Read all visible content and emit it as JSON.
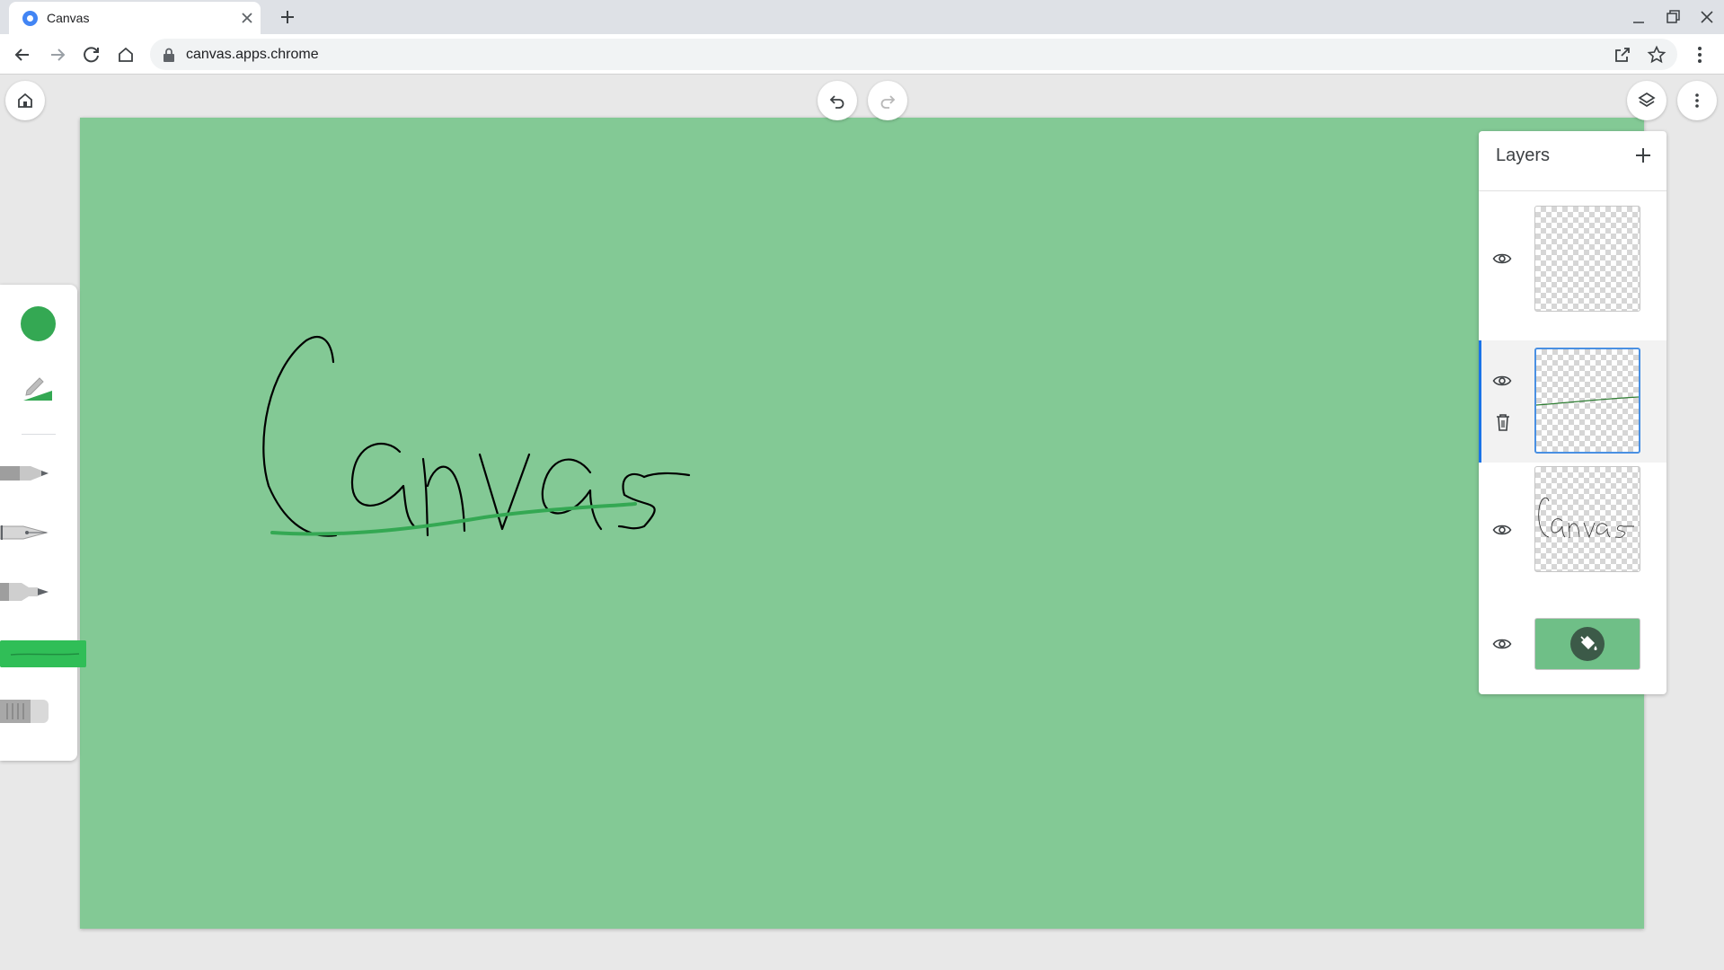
{
  "browser": {
    "tab": {
      "title": "Canvas"
    },
    "url": "canvas.apps.chrome"
  },
  "canvas": {
    "background_color": "#83c995",
    "handwriting_text": "Canvas",
    "stroke_color": "#000000",
    "underline_color": "#34a853"
  },
  "palette": {
    "selected_color": "#34a853",
    "tools": [
      {
        "name": "pencil"
      },
      {
        "name": "fountain-pen"
      },
      {
        "name": "marker"
      },
      {
        "name": "highlighter",
        "selected": true
      },
      {
        "name": "eraser"
      }
    ]
  },
  "layers": {
    "title": "Layers",
    "items": [
      {
        "content": "empty",
        "visible": true
      },
      {
        "content": "underline-stroke",
        "visible": true,
        "active": true
      },
      {
        "content": "Canvas",
        "visible": true
      },
      {
        "content": "background-fill",
        "visible": true,
        "color": "#6fbf87"
      }
    ]
  }
}
